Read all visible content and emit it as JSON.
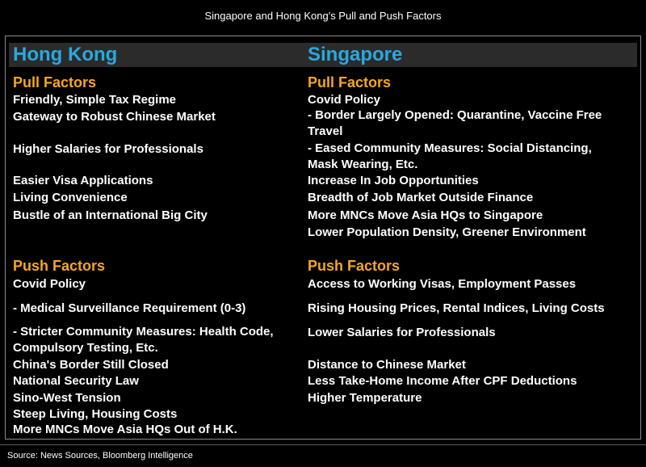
{
  "title": "Singapore and Hong Kong's Pull and Push Factors",
  "hong_kong": {
    "name": "Hong Kong",
    "pull_heading": "Pull Factors",
    "pull": [
      "Friendly, Simple Tax Regime",
      "Gateway to Robust Chinese Market",
      "Higher Salaries for Professionals",
      "Easier Visa Applications",
      "Living Convenience",
      "Bustle of an International Big City"
    ],
    "push_heading": "Push Factors",
    "push": [
      "Covid Policy",
      "- Medical Surveillance Requirement (0-3)",
      "- Stricter Community Measures: Health Code,",
      "Compulsory Testing, Etc.",
      "China's Border Still Closed",
      "National Security Law",
      "Sino-West Tension",
      "Steep Living, Housing Costs",
      "More MNCs Move Asia HQs Out of H.K."
    ]
  },
  "singapore": {
    "name": "Singapore",
    "pull_heading": "Pull Factors",
    "pull": [
      "Covid Policy",
      "- Border Largely Opened: Quarantine, Vaccine Free",
      "Travel",
      "- Eased Community Measures: Social Distancing,",
      "Mask Wearing, Etc.",
      "Increase In Job Opportunities",
      "Breadth of Job Market Outside Finance",
      "More MNCs Move Asia HQs to Singapore",
      "Lower Population Density, Greener Environment"
    ],
    "push_heading": "Push Factors",
    "push": [
      "Access to Working Visas, Employment Passes",
      "Rising Housing Prices, Rental Indices, Living Costs",
      "Lower Salaries for Professionals",
      "Distance to Chinese Market",
      "Less Take-Home Income After CPF Deductions",
      "Higher Temperature"
    ]
  },
  "source": "Source: News Sources, Bloomberg Intelligence",
  "colors": {
    "heading_blue": "#29a8e0",
    "section_orange": "#f5a623",
    "background": "#000000"
  }
}
